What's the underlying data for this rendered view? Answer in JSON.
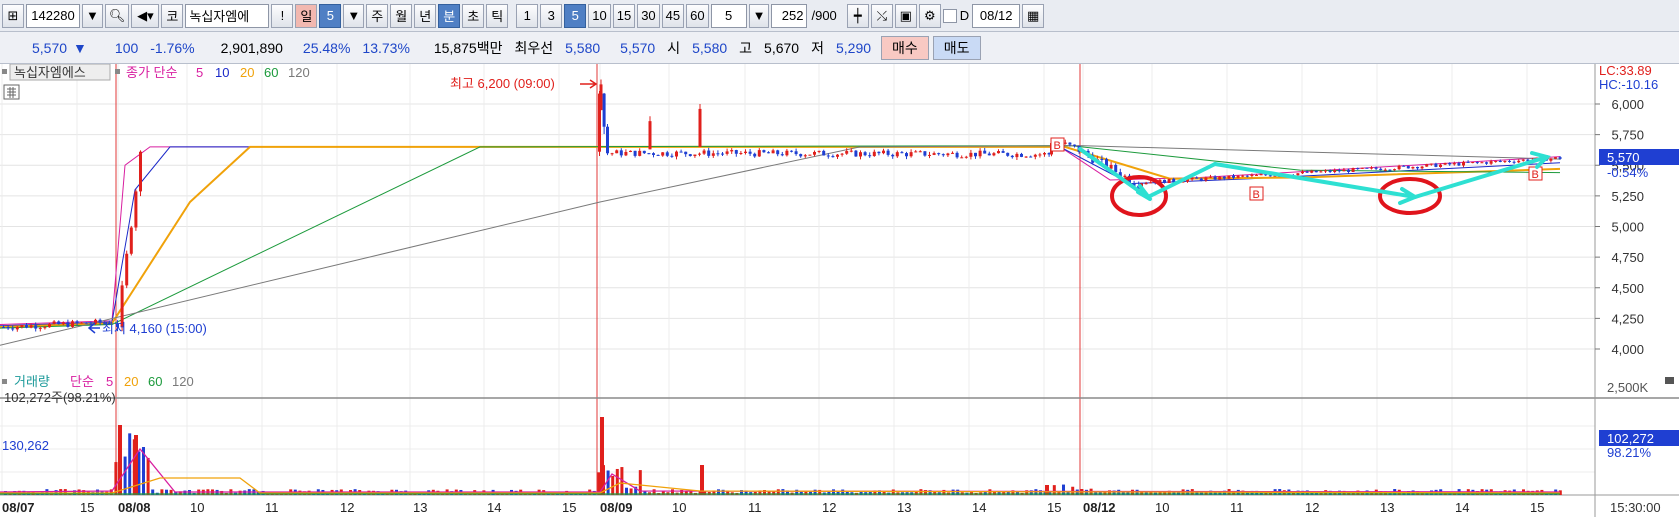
{
  "toolbar": {
    "code": "142280",
    "name": "녹십자엠에",
    "market_prefix": "코",
    "alert": "!",
    "period_day": "일",
    "period_n": "5",
    "period_week": "주",
    "period_month": "월",
    "period_year": "년",
    "period_minute": "분",
    "period_second": "초",
    "period_tick": "틱",
    "intervals": [
      "1",
      "3",
      "5",
      "10",
      "15",
      "30",
      "45",
      "60"
    ],
    "interval_active": "5",
    "custom_interval": "5",
    "count": "252",
    "count_total": "/900",
    "date_checkbox_label": "D",
    "date": "08/12"
  },
  "info": {
    "price": "5,570",
    "change": "100",
    "change_pct": "-1.76%",
    "volume": "2,901,890",
    "ratio1": "25.48%",
    "ratio2": "13.73%",
    "amount": "15,875백만",
    "best_label": "최우선",
    "best_ask": "5,580",
    "best_bid": "5,570",
    "open_label": "시",
    "open": "5,580",
    "high_label": "고",
    "high": "5,670",
    "low_label": "저",
    "low": "5,290",
    "buy_label": "매수",
    "sell_label": "매도"
  },
  "price_panel": {
    "stock_label": "녹십자엠에스",
    "ma_title": "종가 단순",
    "ma_periods": [
      "5",
      "10",
      "20",
      "60",
      "120"
    ],
    "ma_colors": [
      "#d81ea0",
      "#1a28c8",
      "#f0a20a",
      "#1c9a3c",
      "#7a7a7a"
    ],
    "high_note": "최고 6,200 (09:00)",
    "low_note": "최저 4,160 (15:00)",
    "lc": "LC:33.89",
    "hc": "HC:-10.16",
    "current_price": "5,570",
    "current_pct": "-0.54%",
    "y_ticks": [
      "6,000",
      "5,750",
      "5,500",
      "5,250",
      "5,000",
      "4,750",
      "4,500",
      "4,250",
      "4,000"
    ],
    "b_marker": "B"
  },
  "volume_panel": {
    "title": "거래량",
    "ma_title": "단순",
    "ma_periods": [
      "5",
      "20",
      "60",
      "120"
    ],
    "ma_colors": [
      "#d81ea0",
      "#f0a20a",
      "#1c9a3c",
      "#7a7a7a"
    ],
    "last_volume": "102,272주(98.21%)",
    "ref_value": "130,262",
    "y_top": "2,500K",
    "current_volume": "102,272",
    "current_pct": "98.21%"
  },
  "x_axis": {
    "labels": [
      {
        "text": "08/07",
        "bold": true
      },
      {
        "text": "15",
        "bold": false
      },
      {
        "text": "08/08",
        "bold": true
      },
      {
        "text": "10",
        "bold": false
      },
      {
        "text": "11",
        "bold": false
      },
      {
        "text": "12",
        "bold": false
      },
      {
        "text": "13",
        "bold": false
      },
      {
        "text": "14",
        "bold": false
      },
      {
        "text": "15",
        "bold": false
      },
      {
        "text": "08/09",
        "bold": true
      },
      {
        "text": "10",
        "bold": false
      },
      {
        "text": "11",
        "bold": false
      },
      {
        "text": "12",
        "bold": false
      },
      {
        "text": "13",
        "bold": false
      },
      {
        "text": "14",
        "bold": false
      },
      {
        "text": "15",
        "bold": false
      },
      {
        "text": "08/12",
        "bold": true
      },
      {
        "text": "10",
        "bold": false
      },
      {
        "text": "11",
        "bold": false
      },
      {
        "text": "12",
        "bold": false
      },
      {
        "text": "13",
        "bold": false
      },
      {
        "text": "14",
        "bold": false
      },
      {
        "text": "15",
        "bold": false
      }
    ],
    "time": "15:30:00"
  },
  "colors": {
    "up": "#e0201c",
    "down": "#1f3fd2",
    "annotation_arrow": "#2ee0d2",
    "annotation_circle": "#e0141c",
    "day_separator": "#e23a3a"
  }
}
